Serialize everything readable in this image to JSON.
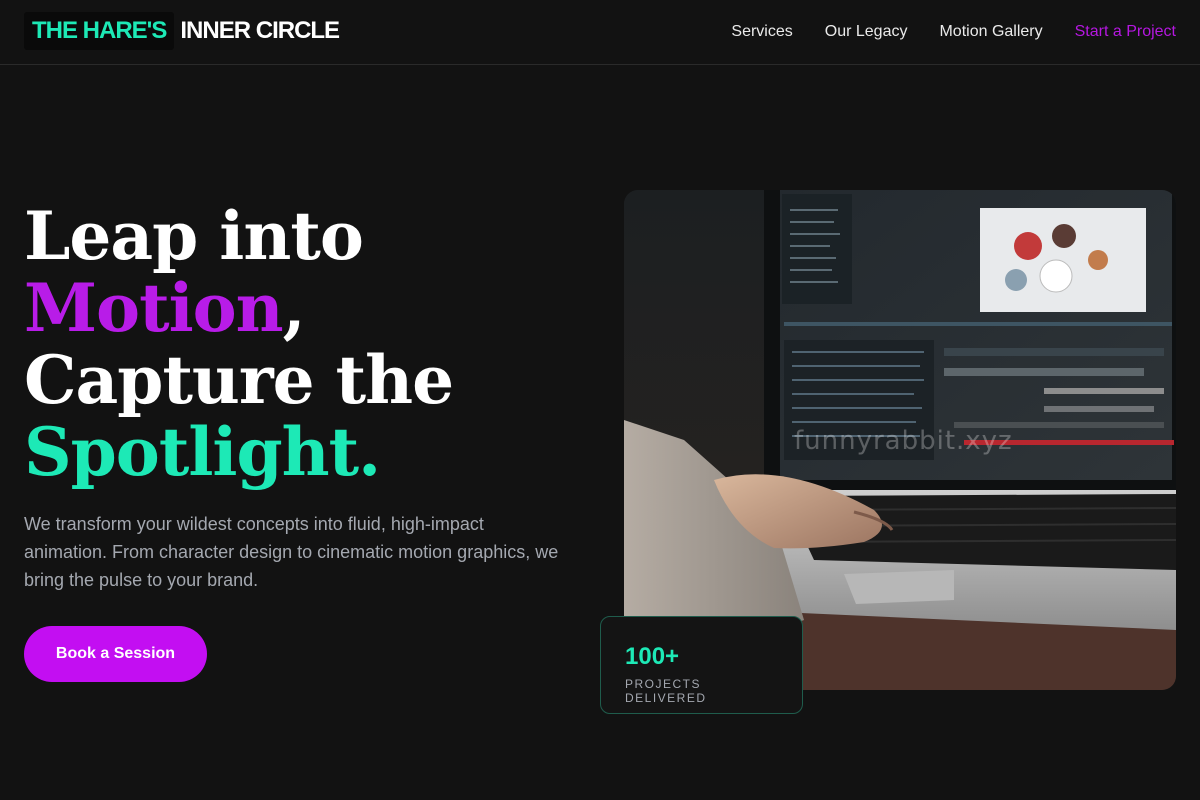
{
  "nav": {
    "logo_accent": "THE HARE'S",
    "logo_rest": "INNER CIRCLE",
    "links": [
      "Services",
      "Our Legacy",
      "Motion Gallery"
    ],
    "cta": "Start a Project"
  },
  "hero": {
    "title": {
      "line1": "Leap into",
      "line2_accent": "Motion",
      "line2_rest": ",",
      "line3": "Capture the",
      "line4_accent": "Spotlight."
    },
    "subtitle": "We transform your wildest concepts into fluid, high-impact animation. From character design to cinematic motion graphics, we bring the pulse to your brand.",
    "button_label": "Book a Session",
    "image_watermark": "funnyrabbit.xyz"
  },
  "stat": {
    "value": "100+",
    "label": "PROJECTS DELIVERED"
  },
  "colors": {
    "background": "#121212",
    "accent_teal": "#1de9b6",
    "accent_purple": "#c30ef2",
    "muted_text": "#a4a8b0"
  }
}
